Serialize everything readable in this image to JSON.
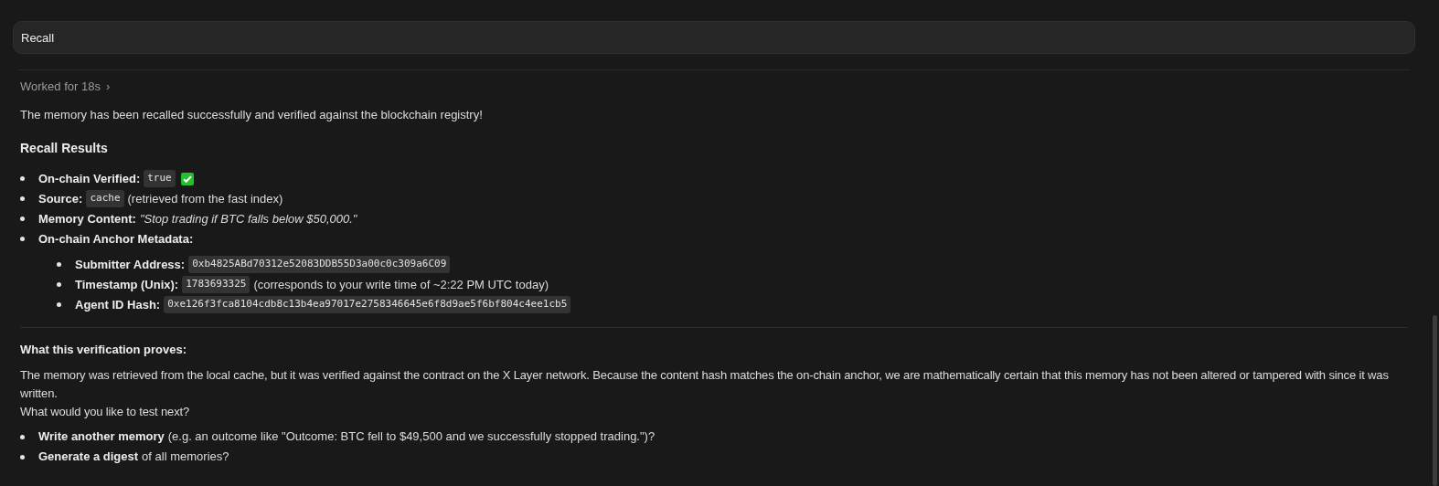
{
  "prompt_field": {
    "value": "Recall"
  },
  "worked": {
    "label": "Worked for 18s",
    "chevron": "›",
    "expanded": false
  },
  "intro": "The memory has been recalled successfully and verified against the blockchain registry!",
  "results": {
    "heading": "Recall Results",
    "items": [
      {
        "label": "On-chain Verified:",
        "code": "true",
        "verified": true
      },
      {
        "label": "Source:",
        "code": "cache",
        "text": "(retrieved from the fast index)"
      },
      {
        "label": "Memory Content:",
        "text": "*\"Stop trading if BTC falls below $50,000.\"*"
      },
      {
        "label": "On-chain Anchor Metadata:",
        "children": [
          {
            "label": "Submitter Address:",
            "code": "0xb4825ABd70312e52083DDB55D3a00c0c309a6C09"
          },
          {
            "label": "Timestamp (Unix):",
            "code": "1783693325",
            "text": "(corresponds to your write time of ~2:22 PM UTC today)"
          },
          {
            "label": "Agent ID Hash:",
            "code": "0xe126f3fca8104cdb8c13b4ea97017e2758346645e6f8d9ae5f6bf804c4ee1cb5"
          }
        ]
      }
    ]
  },
  "proof": {
    "heading": "What this verification proves:",
    "paragraphs": [
      "The memory was retrieved from the local cache, but it was verified against the contract on the X Layer network. Because the content hash matches the on-chain anchor, we are mathematically certain that this memory has not been altered or tampered with since it was written.",
      "What would you like to test next?"
    ],
    "items": [
      {
        "label": "Write another memory",
        "text": "(e.g. an outcome like \"Outcome: BTC fell to $49,500 and we successfully stopped trading.\")?"
      },
      {
        "label": "Generate a digest",
        "text": "of all memories?"
      }
    ]
  }
}
